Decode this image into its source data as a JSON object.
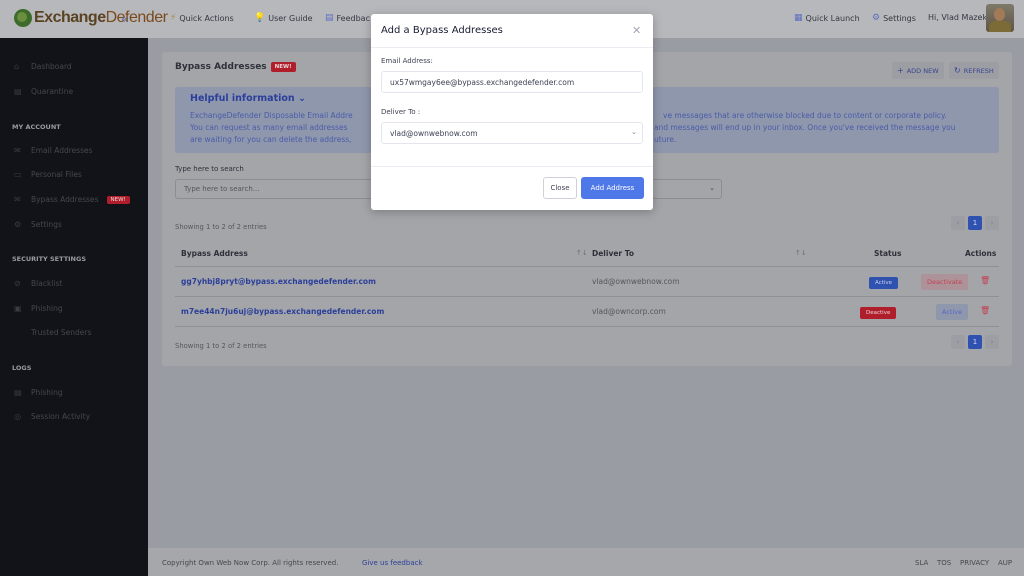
{
  "brand": {
    "logo_main": "Exchange",
    "logo_accent": "Defender",
    "collapse_icon": "chevrons-left-icon"
  },
  "topnav": {
    "quick_actions": "Quick Actions",
    "user_guide": "User Guide",
    "feedback": "Feedbac",
    "quick_launch": "Quick Launch",
    "settings": "Settings",
    "greeting": "Hi, Vlad Mazek"
  },
  "sidebar": {
    "dashboard": "Dashboard",
    "quarantine": "Quarantine",
    "my_account": "MY ACCOUNT",
    "email_addresses": "Email Addresses",
    "personal_files": "Personal Files",
    "bypass_addresses": "Bypass Addresses",
    "bypass_badge": "NEW!",
    "settings": "Settings",
    "security_settings": "SECURITY SETTINGS",
    "blacklist": "Blacklist",
    "phishing": "Phishing",
    "trusted_senders": "Trusted Senders",
    "logs": "LOGS",
    "logs_phishing": "Phishing",
    "session_activity": "Session Activity"
  },
  "page": {
    "title": "Bypass Addresses",
    "title_badge": "NEW!",
    "add_new": "ADD NEW",
    "refresh": "REFRESH"
  },
  "info": {
    "title": "Helpful information",
    "line1a": "ExchangeDefender Disposable Email Addre",
    "line1b": "ve messages that are otherwise blocked due to content or corporate policy.",
    "line2a": "You can request as many email addresses",
    "line2b": "and messages will end up in your inbox. Once you've received the message you",
    "line3a": "are waiting for you can delete the address,",
    "line3b": "uture."
  },
  "search": {
    "label": "Type here to search",
    "placeholder": "Type here to search..."
  },
  "table": {
    "showing_top": "Showing 1 to 2 of 2 entries",
    "showing_bottom": "Showing 1 to 2 of 2 entries",
    "col_address": "Bypass Address",
    "col_deliver": "Deliver To",
    "col_status": "Status",
    "col_actions": "Actions",
    "page_current": "1",
    "rows": [
      {
        "address": "gg7yhbj8pryt@bypass.exchangedefender.com",
        "deliver": "vlad@ownwebnow.com",
        "status": "Active",
        "action": "Deactivate"
      },
      {
        "address": "m7ee44n7ju6uj@bypass.exchangedefender.com",
        "deliver": "vlad@owncorp.com",
        "status": "Deactive",
        "action": "Active"
      }
    ]
  },
  "footer": {
    "copyright": "Copyright Own Web Now Corp. All rights reserved.",
    "feedback": "Give us feedback",
    "sla": "SLA",
    "tos": "TOS",
    "privacy": "PRIVACY",
    "aup": "AUP"
  },
  "modal": {
    "title": "Add a Bypass Addresses",
    "email_label": "Email Address:",
    "email_value": "ux57wmgay6ee@bypass.exchangedefender.com",
    "deliver_label": "Deliver To :",
    "deliver_value": "vlad@ownwebnow.com",
    "close_button": "Close",
    "add_button": "Add Address"
  },
  "colors": {
    "primary": "#4e78e8",
    "danger": "#b01e2b",
    "sidebar_bg": "#121318"
  }
}
